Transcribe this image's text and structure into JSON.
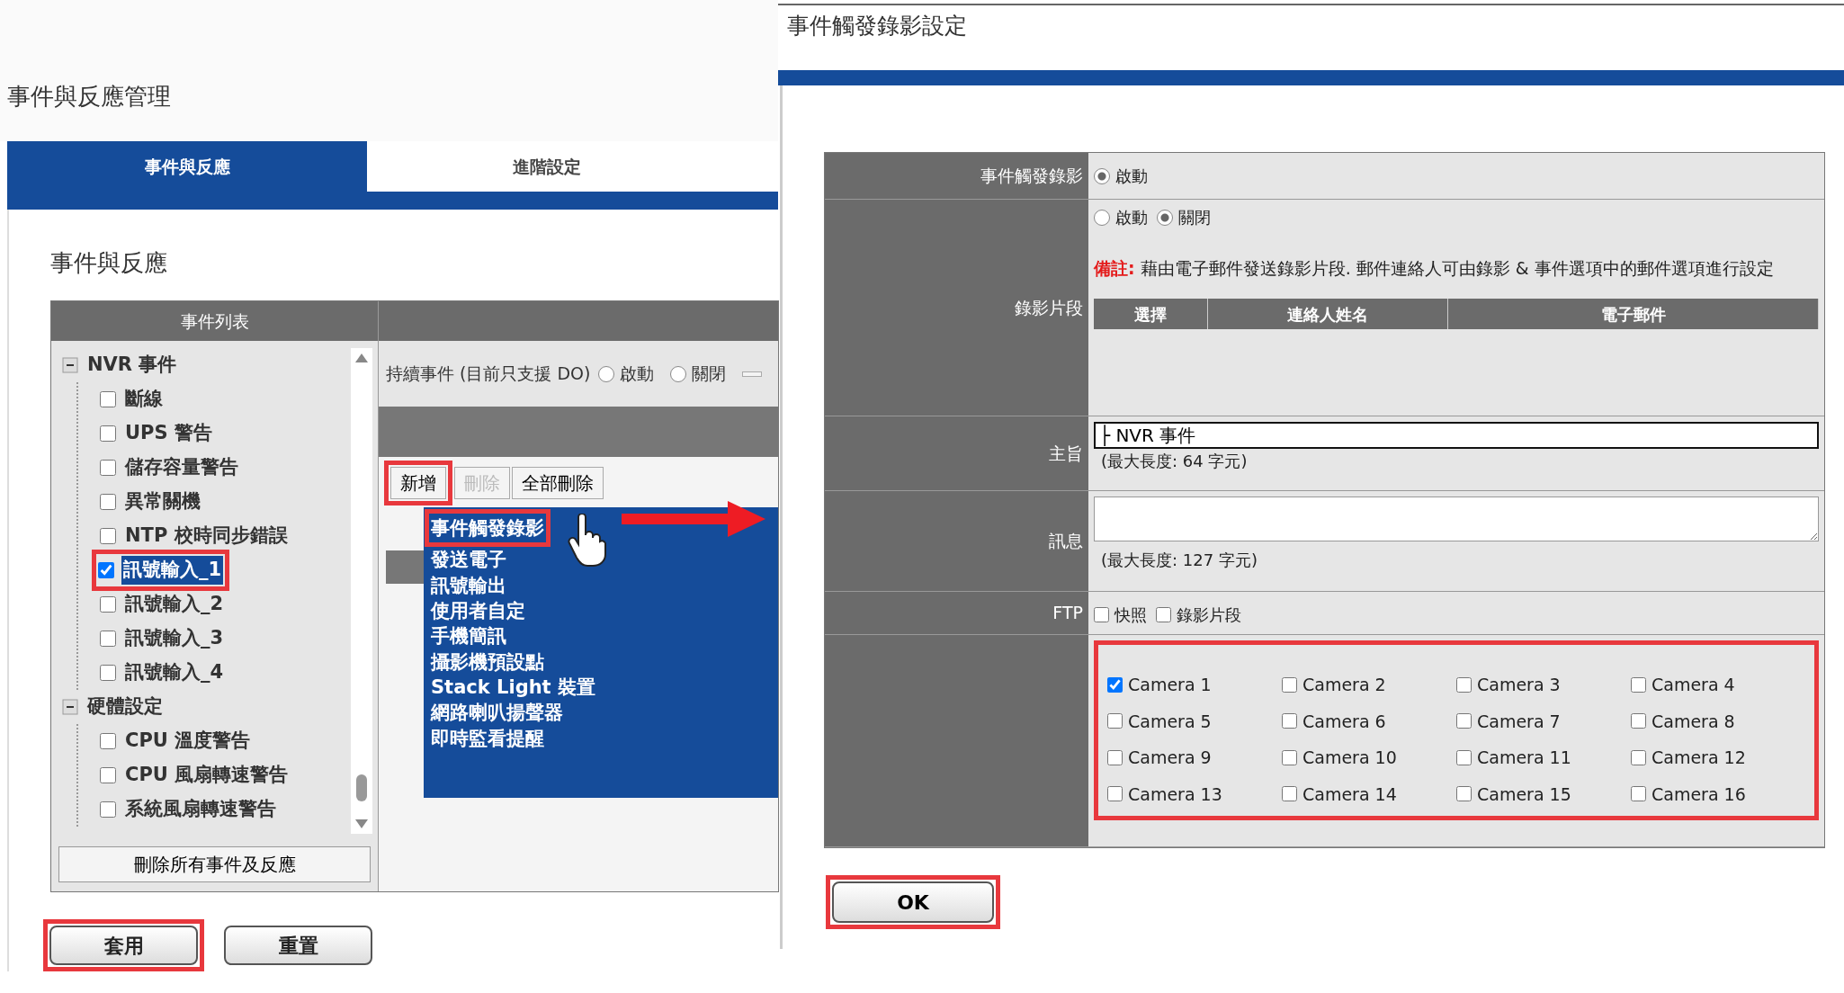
{
  "left_panel": {
    "title": "事件與反應管理",
    "tabs": [
      {
        "label": "事件與反應",
        "selected": true
      },
      {
        "label": "進階設定",
        "selected": false
      }
    ],
    "section_title": "事件與反應",
    "event_list": {
      "header": "事件列表",
      "groups": [
        {
          "label": "NVR 事件",
          "expanded": true,
          "children": [
            {
              "label": "斷線",
              "checked": false,
              "selected": false,
              "highlighted": false
            },
            {
              "label": "UPS 警告",
              "checked": false,
              "selected": false,
              "highlighted": false
            },
            {
              "label": "儲存容量警告",
              "checked": false,
              "selected": false,
              "highlighted": false
            },
            {
              "label": "異常關機",
              "checked": false,
              "selected": false,
              "highlighted": false
            },
            {
              "label": "NTP 校時同步錯誤",
              "checked": false,
              "selected": false,
              "highlighted": false
            },
            {
              "label": "訊號輸入_1",
              "checked": true,
              "selected": true,
              "highlighted": true
            },
            {
              "label": "訊號輸入_2",
              "checked": false,
              "selected": false,
              "highlighted": false
            },
            {
              "label": "訊號輸入_3",
              "checked": false,
              "selected": false,
              "highlighted": false
            },
            {
              "label": "訊號輸入_4",
              "checked": false,
              "selected": false,
              "highlighted": false
            }
          ]
        },
        {
          "label": "硬體設定",
          "expanded": true,
          "children": [
            {
              "label": "CPU 溫度警告",
              "checked": false,
              "selected": false,
              "highlighted": false
            },
            {
              "label": "CPU 風扇轉速警告",
              "checked": false,
              "selected": false,
              "highlighted": false
            },
            {
              "label": "系統風扇轉速警告",
              "checked": false,
              "selected": false,
              "highlighted": false
            }
          ]
        }
      ],
      "delete_all_button": "刪除所有事件及反應"
    },
    "response_panel": {
      "continuous_event": {
        "label": "持續事件 (目前只支援 DO)",
        "options": [
          {
            "label": "啟動",
            "selected": false
          },
          {
            "label": "關閉",
            "selected": false
          }
        ]
      },
      "toolbar": [
        {
          "label": "新增",
          "disabled": false,
          "highlighted": true
        },
        {
          "label": "刪除",
          "disabled": true,
          "highlighted": false
        },
        {
          "label": "全部刪除",
          "disabled": false,
          "highlighted": false
        }
      ],
      "menu": [
        {
          "label": "事件觸發錄影",
          "highlighted": true
        },
        {
          "label": "發送電子",
          "highlighted": false
        },
        {
          "label": "訊號輸出",
          "highlighted": false
        },
        {
          "label": "使用者自定",
          "highlighted": false
        },
        {
          "label": "手機簡訊",
          "highlighted": false
        },
        {
          "label": "攝影機預設點",
          "highlighted": false
        },
        {
          "label": "Stack Light 裝置",
          "highlighted": false
        },
        {
          "label": "網路喇叭揚聲器",
          "highlighted": false
        },
        {
          "label": "即時監看提醒",
          "highlighted": false
        }
      ]
    },
    "buttons": [
      {
        "label": "套用",
        "highlighted": true
      },
      {
        "label": "重置",
        "highlighted": false
      }
    ]
  },
  "right_panel": {
    "title": "事件觸發錄影設定",
    "event_recording": {
      "label": "事件觸發錄影",
      "options": [
        {
          "label": "啟動",
          "selected": true
        }
      ]
    },
    "clip": {
      "label": "錄影片段",
      "options": [
        {
          "label": "啟動",
          "selected": false
        },
        {
          "label": "關閉",
          "selected": true
        }
      ],
      "note": "**備註:** 藉由電子郵件發送錄影片段. 郵件連絡人可由錄影 & 事件選項中的郵件選項進行設定",
      "columns": [
        "選擇",
        "連絡人姓名",
        "電子郵件"
      ]
    },
    "subject": {
      "label": "主旨",
      "value": "├ NVR 事件",
      "hint": "(最大長度: 64 字元)"
    },
    "message": {
      "label": "訊息",
      "hint": "(最大長度: 127 字元)"
    },
    "ftp": {
      "label": "FTP",
      "options": [
        {
          "label": "快照",
          "checked": false
        },
        {
          "label": "錄影片段",
          "checked": false
        }
      ]
    },
    "cameras": {
      "highlighted": true,
      "items": [
        {
          "label": "Camera 1",
          "checked": true
        },
        {
          "label": "Camera 2",
          "checked": false
        },
        {
          "label": "Camera 3",
          "checked": false
        },
        {
          "label": "Camera 4",
          "checked": false
        },
        {
          "label": "Camera 5",
          "checked": false
        },
        {
          "label": "Camera 6",
          "checked": false
        },
        {
          "label": "Camera 7",
          "checked": false
        },
        {
          "label": "Camera 8",
          "checked": false
        },
        {
          "label": "Camera 9",
          "checked": false
        },
        {
          "label": "Camera 10",
          "checked": false
        },
        {
          "label": "Camera 11",
          "checked": false
        },
        {
          "label": "Camera 12",
          "checked": false
        },
        {
          "label": "Camera 13",
          "checked": false
        },
        {
          "label": "Camera 14",
          "checked": false
        },
        {
          "label": "Camera 15",
          "checked": false
        },
        {
          "label": "Camera 16",
          "checked": false
        }
      ]
    },
    "ok_button": {
      "label": "OK",
      "highlighted": true
    }
  }
}
